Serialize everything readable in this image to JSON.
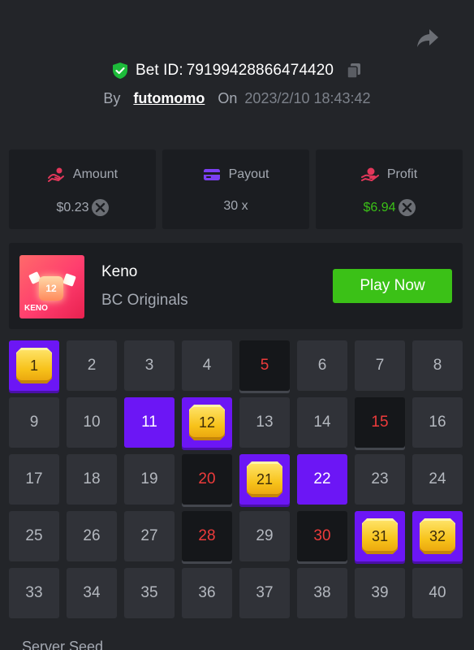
{
  "header": {
    "bet_id_label": "Bet ID:",
    "bet_id": "79199428866474420",
    "by_label": "By",
    "username": "futomomo",
    "on_label": "On",
    "datetime": "2023/2/10 18:43:42"
  },
  "stats": {
    "amount": {
      "label": "Amount",
      "value": "$0.23"
    },
    "payout": {
      "label": "Payout",
      "value": "30 x"
    },
    "profit": {
      "label": "Profit",
      "value": "$6.94"
    }
  },
  "game": {
    "name": "Keno",
    "provider": "BC Originals",
    "thumb_number": "12",
    "thumb_brand": "KENO",
    "play_button": "Play Now"
  },
  "board": {
    "numbers": [
      "1",
      "2",
      "3",
      "4",
      "5",
      "6",
      "7",
      "8",
      "9",
      "10",
      "11",
      "12",
      "13",
      "14",
      "15",
      "16",
      "17",
      "18",
      "19",
      "20",
      "21",
      "22",
      "23",
      "24",
      "25",
      "26",
      "27",
      "28",
      "29",
      "30",
      "31",
      "32",
      "33",
      "34",
      "35",
      "36",
      "37",
      "38",
      "39",
      "40"
    ],
    "hits": [
      1,
      12,
      21,
      31,
      32
    ],
    "picked_not_drawn": [
      11,
      22
    ],
    "drawn_not_picked": [
      5,
      15,
      20,
      28,
      30
    ]
  },
  "footer": {
    "server_seed_label": "Server Seed"
  },
  "colors": {
    "background": "#232529",
    "card": "#1b1d21",
    "accent_purple": "#6c16f5",
    "green": "#3bc117",
    "red": "#ed3b3b",
    "gold": "#f7c21a"
  }
}
